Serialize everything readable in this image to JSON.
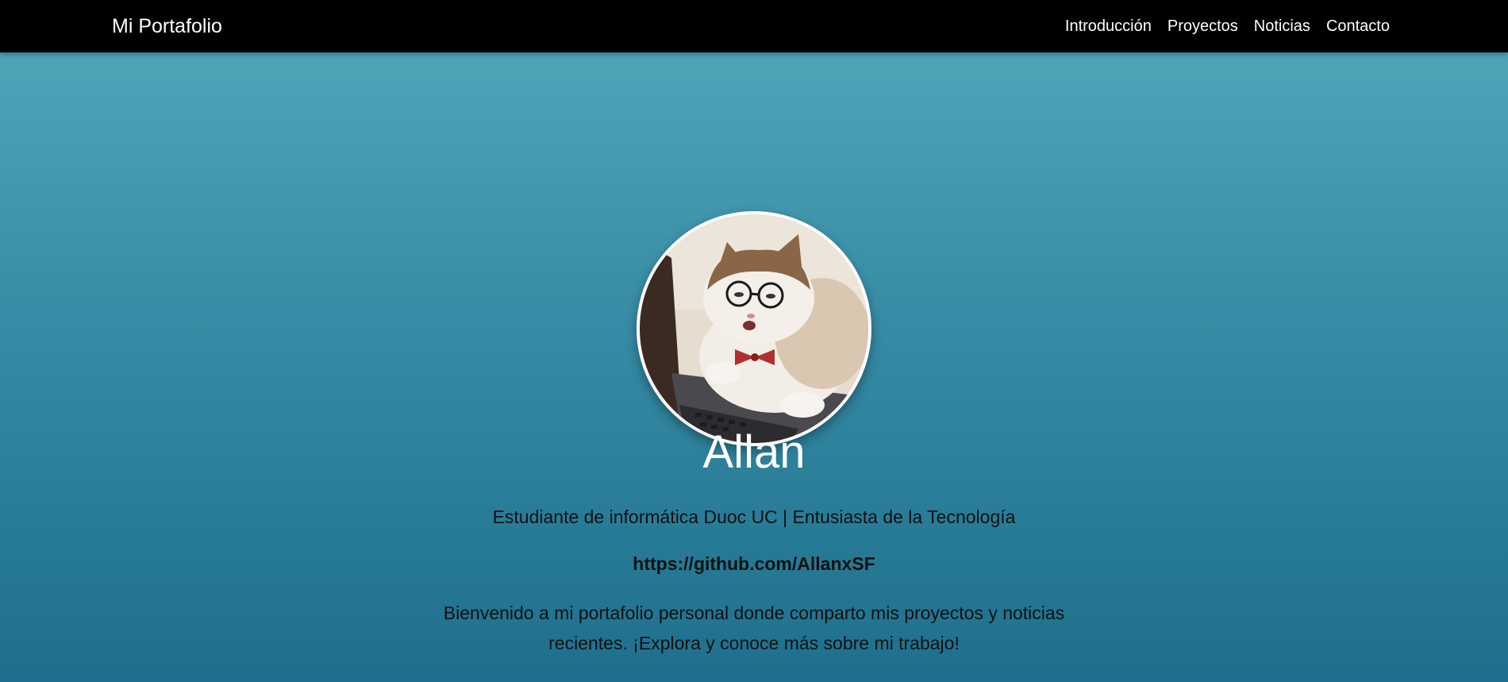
{
  "navbar": {
    "brand": "Mi Portafolio",
    "links": [
      "Introducción",
      "Proyectos",
      "Noticias",
      "Contacto"
    ]
  },
  "hero": {
    "name": "Allan",
    "tagline": "Estudiante de informática Duoc UC | Entusiasta de la Tecnología",
    "github": "https://github.com/AllanxSF",
    "welcome": "Bienvenido a mi portafolio personal donde comparto mis proyectos y noticias recientes. ¡Explora y conoce más sobre mi trabajo!"
  },
  "colors": {
    "navbar_bg": "#000000",
    "hero_top": "#50a4b8",
    "hero_bottom": "#1e6f8d",
    "text_dark": "#111111",
    "text_light": "#ffffff"
  },
  "icons": {
    "avatar": "cat-with-glasses-photo"
  }
}
